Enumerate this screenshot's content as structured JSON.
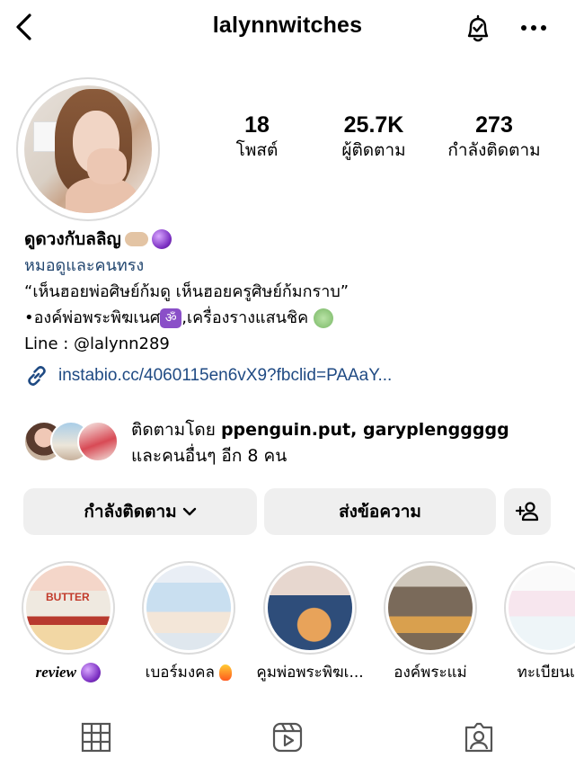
{
  "header": {
    "username": "lalynnwitches"
  },
  "stats": [
    {
      "value": "18",
      "label": "โพสต์"
    },
    {
      "value": "25.7K",
      "label": "ผู้ติดตาม"
    },
    {
      "value": "273",
      "label": "กำลังติดตาม"
    }
  ],
  "bio": {
    "name": "ดูดวงกับลลิญ",
    "category": "หมอดูและคนทรง",
    "line1": "“เห็นฮอยพ่อศิษย์ก้มดู เห็นฮอยครูศิษย์ก้มกราบ”",
    "line2_prefix": "•องค์พ่อพระพิฆเนศ",
    "line2_emoji": "ॐ",
    "line2_suffix": ",เครื่องรางแสนชิค",
    "line3": "Line : @lalynn289",
    "link": "instabio.cc/4060115en6vX9?fbclid=PAAaY..."
  },
  "followed_by": {
    "prefix": "ติดตามโดย ",
    "names": "ppenguin.put, garyplenggggg",
    "suffix": "และคนอื่นๆ อีก 8 คน"
  },
  "buttons": {
    "following": "กำลังติดตาม",
    "message": "ส่งข้อความ"
  },
  "highlights": [
    {
      "label": "review"
    },
    {
      "label": "เบอร์มงคล"
    },
    {
      "label": "คูมพ่อพระพิฆเ..."
    },
    {
      "label": "องค์พระแม่"
    },
    {
      "label": "ทะเบียนเฮ"
    }
  ],
  "highlight_images": {
    "hl1_text": "BUTTER"
  },
  "colors": {
    "link": "#1f4a83",
    "category": "#22466f",
    "button_bg": "#efefef"
  },
  "icons": {
    "back": "chevron-left-icon",
    "bell": "bell-check-icon",
    "more": "more-horizontal-icon",
    "add_user": "add-user-icon",
    "grid": "grid-icon",
    "reels": "reels-icon",
    "tagged": "tagged-icon"
  }
}
